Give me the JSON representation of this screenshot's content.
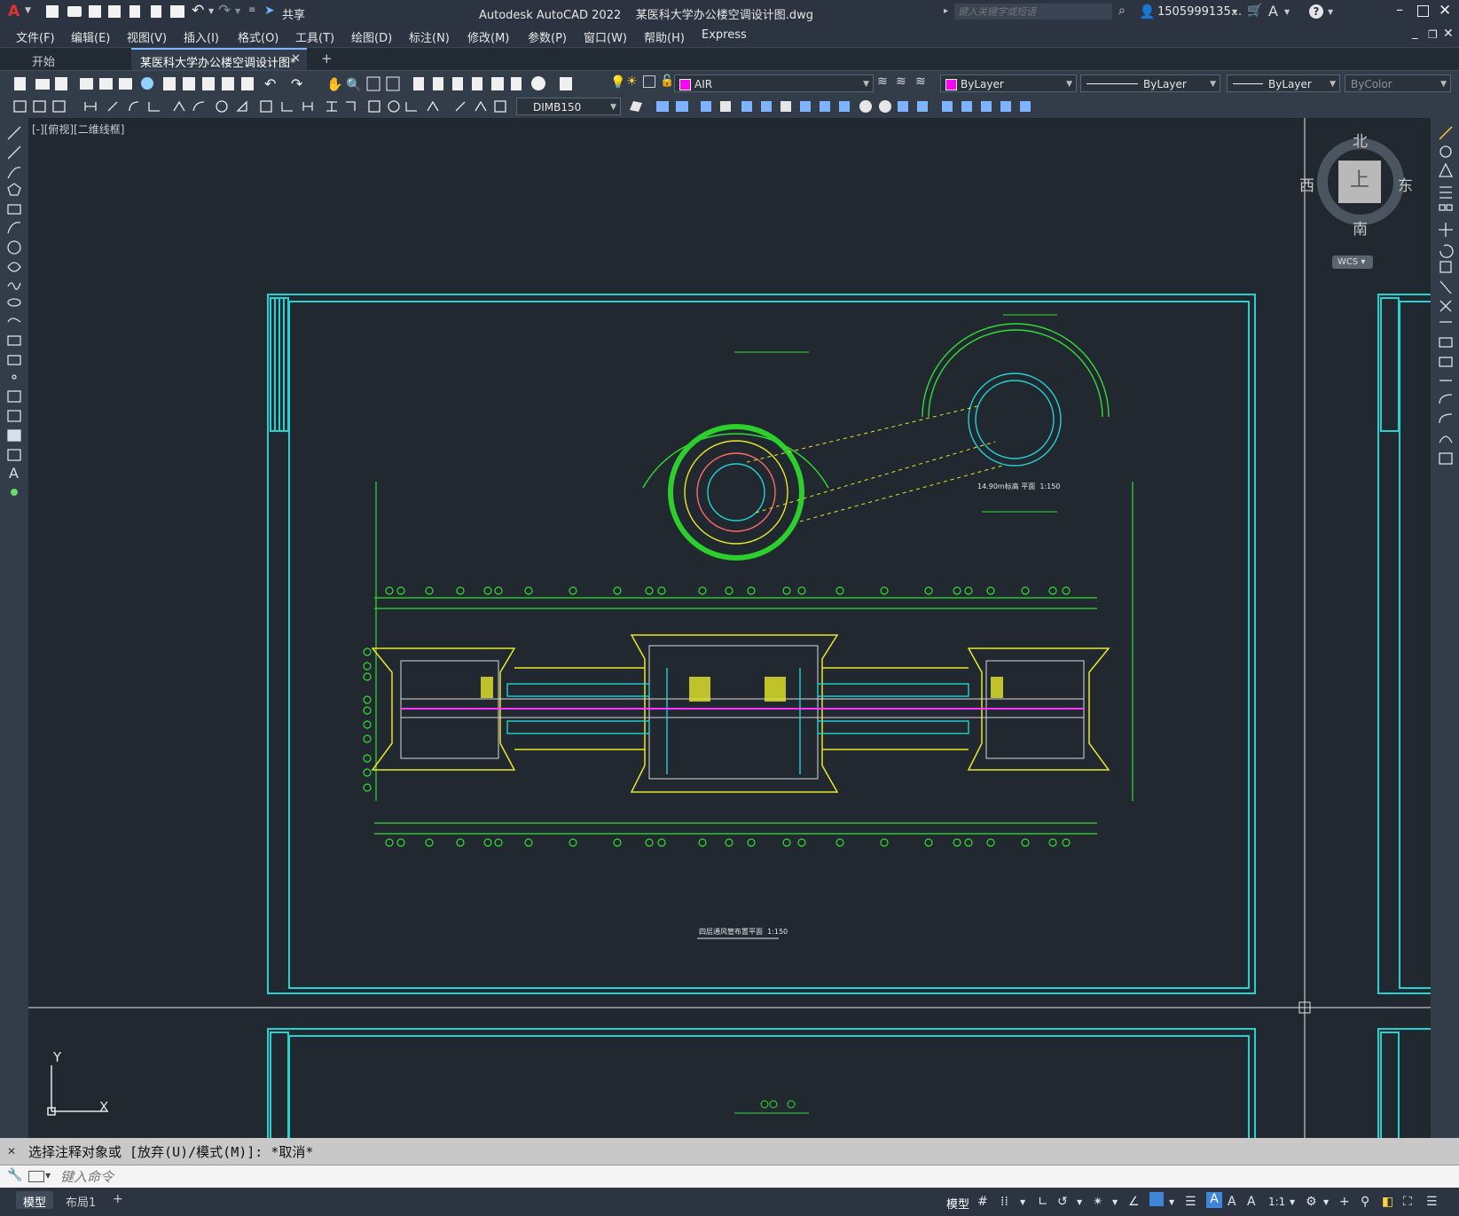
{
  "app": {
    "title": "Autodesk AutoCAD 2022    某医科大学办公楼空调设计图.dwg",
    "logo": "A",
    "share_label": "共享",
    "search_placeholder": "键入关键字或短语",
    "user": "1505999135...",
    "accent_color": "#c8102e"
  },
  "menu": [
    "文件(F)",
    "编辑(E)",
    "视图(V)",
    "插入(I)",
    "格式(O)",
    "工具(T)",
    "绘图(D)",
    "标注(N)",
    "修改(M)",
    "参数(P)",
    "窗口(W)",
    "帮助(H)",
    "Express"
  ],
  "tabs": {
    "start": "开始",
    "active": "某医科大学办公楼空调设计图*",
    "add": "+"
  },
  "toolbar": {
    "layer": "AIR",
    "layer_color": "#ff00ff",
    "color": "ByLayer",
    "color_swatch": "#ff00ff",
    "linetype": "ByLayer",
    "lineweight": "ByLayer",
    "plotstyle": "ByColor",
    "dimstyle": "DIMB150"
  },
  "viewport": {
    "label": "[-][俯视][二维线框]"
  },
  "viewcube": {
    "north": "北",
    "south": "南",
    "east": "东",
    "west": "西",
    "top": "上",
    "wcs": "WCS"
  },
  "drawing": {
    "plan_title": "四层通风管布置平面  1:150",
    "roof_title": "14.90m标高 平面  1:150"
  },
  "ucs": {
    "x": "X",
    "y": "Y"
  },
  "command": {
    "history": "选择注释对象或 [放弃(U)/模式(M)]: *取消*",
    "placeholder": "键入命令"
  },
  "layout_tabs": [
    "模型",
    "布局1",
    "+"
  ],
  "status": {
    "model": "模型",
    "scale": "1:1"
  }
}
